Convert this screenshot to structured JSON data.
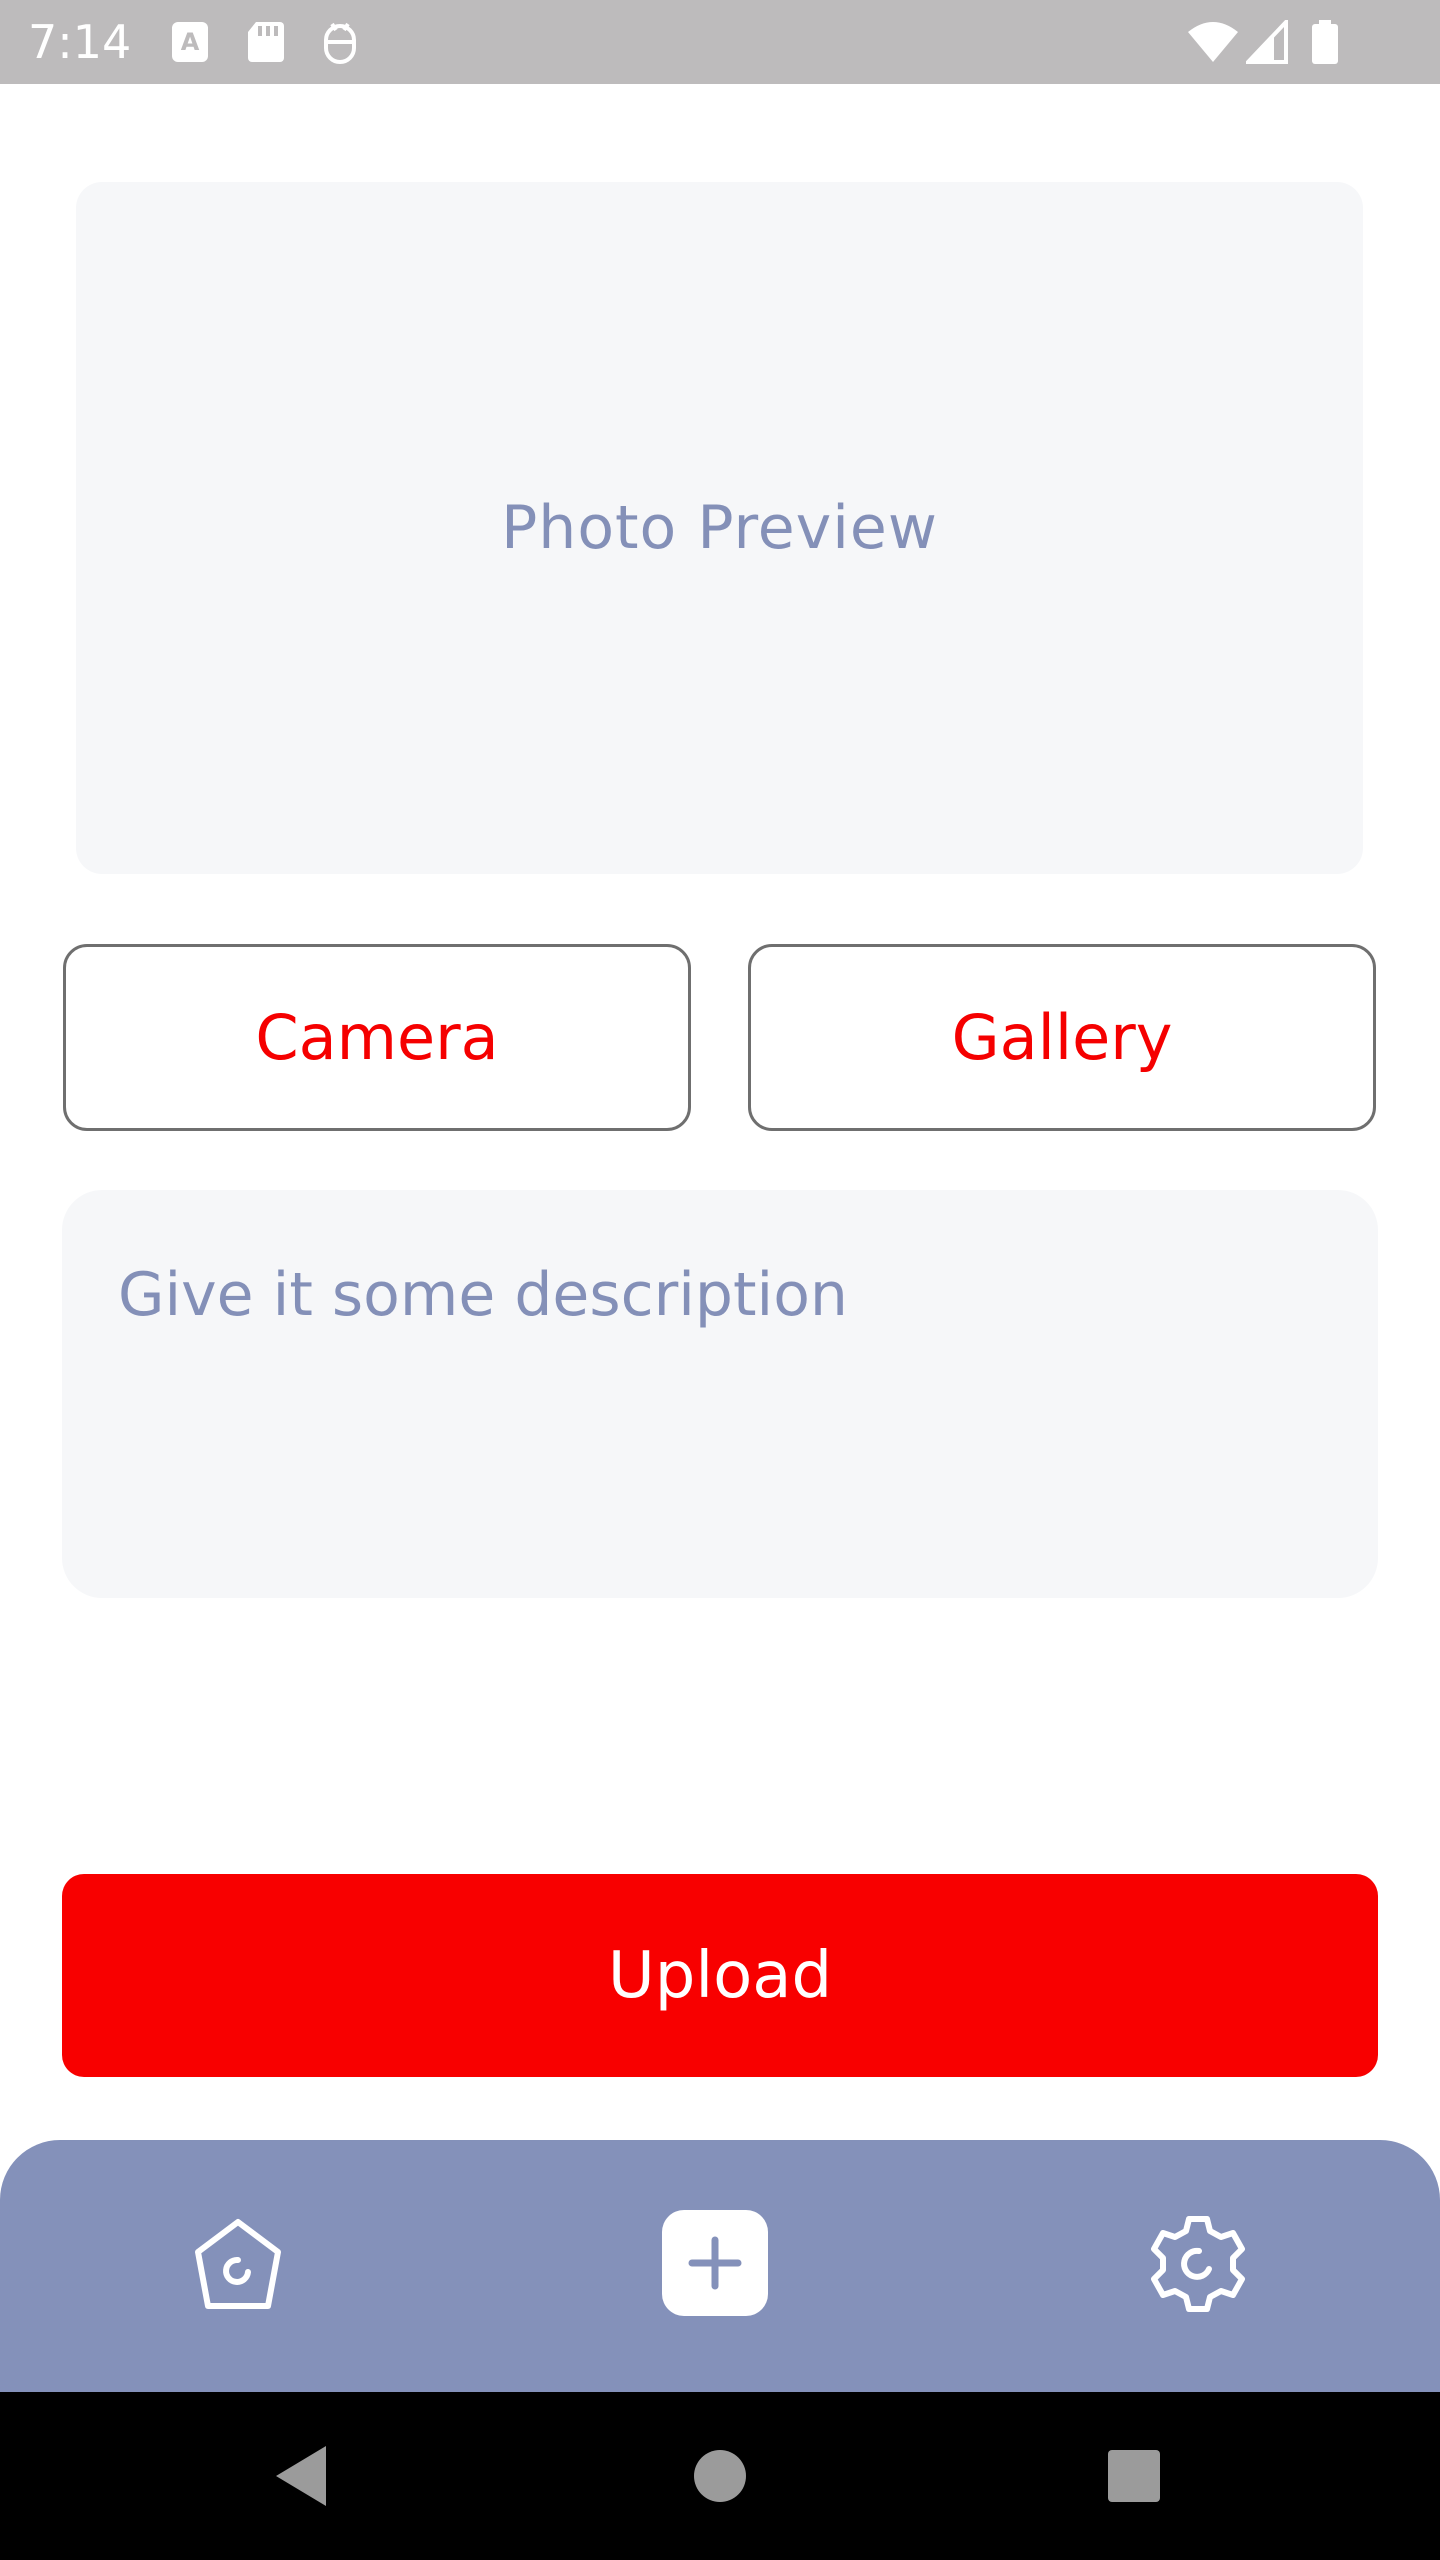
{
  "status_bar": {
    "time": "7:14",
    "icons": [
      "font-notification-icon",
      "sd-card-icon",
      "debug-icon",
      "wifi-icon",
      "signal-icon",
      "battery-icon"
    ]
  },
  "preview": {
    "label": "Photo Preview"
  },
  "buttons": {
    "camera": "Camera",
    "gallery": "Gallery",
    "upload": "Upload"
  },
  "description": {
    "placeholder": "Give it some description",
    "value": ""
  },
  "bottom_nav": {
    "items": [
      "home-icon",
      "add-icon",
      "settings-icon"
    ]
  },
  "system_nav": {
    "items": [
      "back-icon",
      "home-circle-icon",
      "recents-icon"
    ]
  },
  "colors": {
    "accent": "#f80000",
    "nav_background": "#8491ba",
    "placeholder_text": "#8490b8",
    "field_background": "#f6f7f9",
    "status_bar": "#bdbbbc"
  }
}
